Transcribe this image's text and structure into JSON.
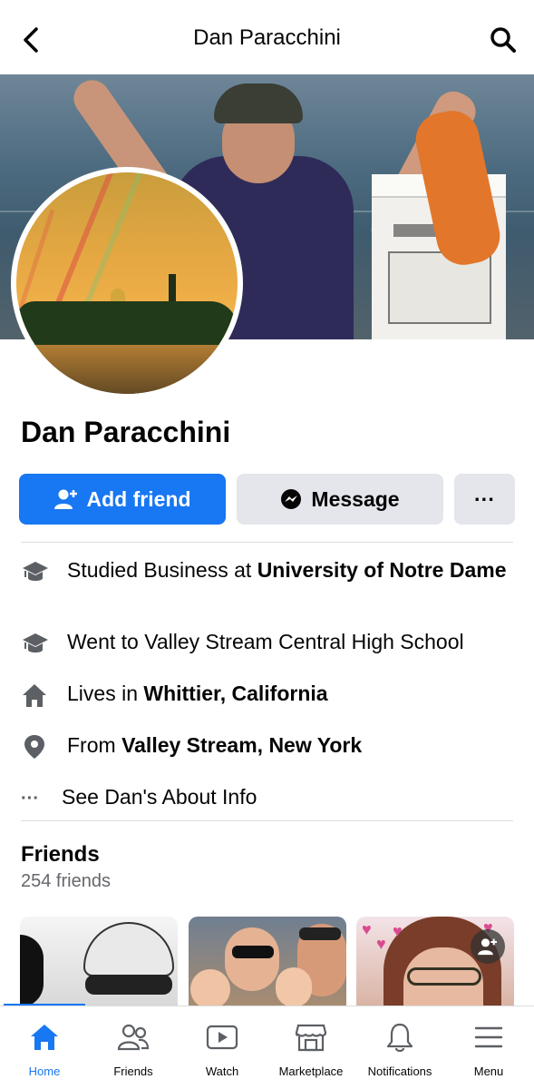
{
  "header": {
    "title": "Dan Paracchini"
  },
  "profile": {
    "name": "Dan Paracchini"
  },
  "actions": {
    "add_friend": "Add friend",
    "message": "Message",
    "more": "···"
  },
  "intro": {
    "education_prefix": "Studied Business at ",
    "education_school": "University of Notre Dame",
    "high_school": "Went to Valley Stream Central High School",
    "lives_prefix": "Lives in ",
    "lives_place": "Whittier, California",
    "from_prefix": "From ",
    "from_place": "Valley Stream, New York",
    "about_link": "See Dan's About Info",
    "about_dots": "···"
  },
  "friends": {
    "title": "Friends",
    "count": "254 friends"
  },
  "tabbar": {
    "tabs": [
      {
        "label": "Home",
        "icon": "home-icon",
        "active": true
      },
      {
        "label": "Friends",
        "icon": "friends-icon",
        "active": false
      },
      {
        "label": "Watch",
        "icon": "watch-icon",
        "active": false
      },
      {
        "label": "Marketplace",
        "icon": "marketplace-icon",
        "active": false
      },
      {
        "label": "Notifications",
        "icon": "bell-icon",
        "active": false
      },
      {
        "label": "Menu",
        "icon": "menu-icon",
        "active": false
      }
    ]
  },
  "colors": {
    "accent": "#1877f2",
    "secondary_button": "#e4e6eb",
    "muted_text": "#65676b"
  }
}
